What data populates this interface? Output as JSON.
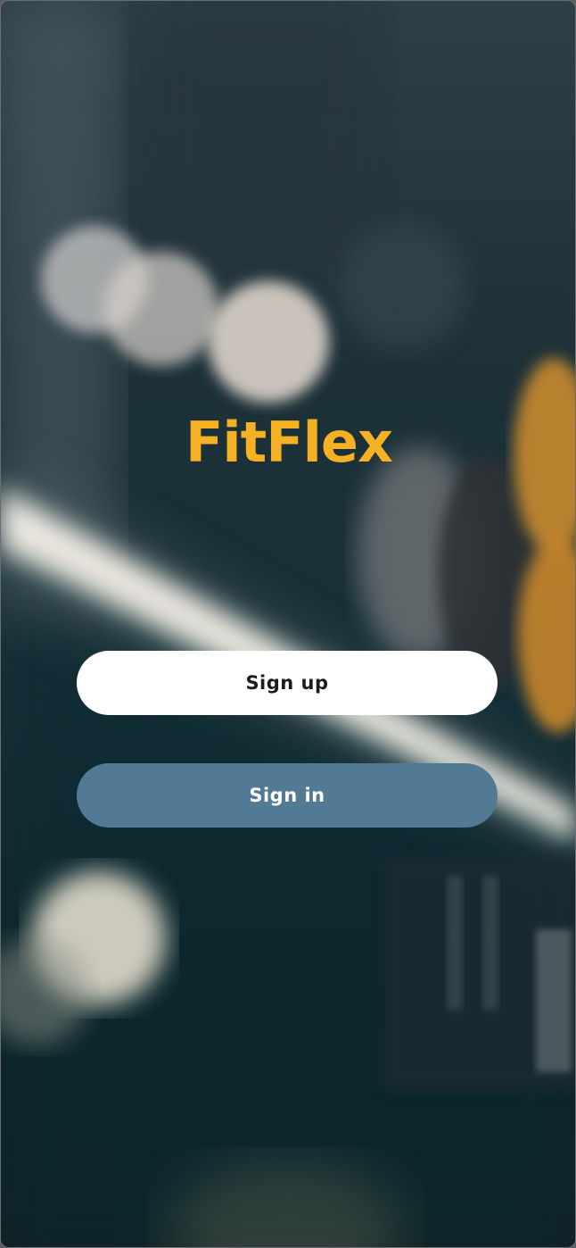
{
  "app": {
    "logo_text": "FitFlex",
    "brand_color": "#f4b123"
  },
  "auth": {
    "signup_label": "Sign up",
    "signin_label": "Sign in",
    "signup_bg": "#ffffff",
    "signin_bg": "#527a94"
  },
  "background": {
    "description_icon": "gym-photo-background"
  }
}
